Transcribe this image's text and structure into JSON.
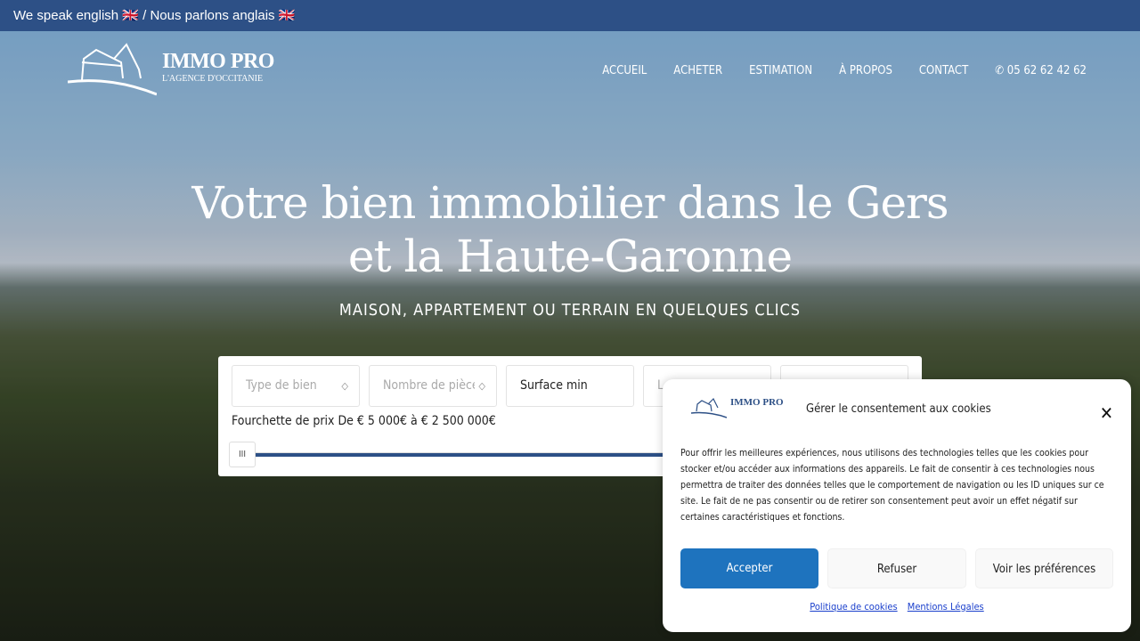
{
  "topbar": {
    "text": "We speak english 🇬🇧 / Nous parlons anglais 🇬🇧"
  },
  "logo": {
    "name": "IMMO PRO",
    "tagline": "L'AGENCE D'OCCITANIE"
  },
  "nav": {
    "items": [
      "ACCUEIL",
      "ACHETER",
      "ESTIMATION",
      "À PROPOS",
      "CONTACT"
    ],
    "phone": "05 62 62 42 62",
    "phone_icon": "phone-ringing-icon"
  },
  "hero": {
    "title_line1": "Votre bien immobilier dans le Gers",
    "title_line2": "et la Haute-Garonne",
    "subtitle": "MAISON, APPARTEMENT OU TERRAIN EN QUELQUES CLICS"
  },
  "search": {
    "type_placeholder": "Type de bien",
    "rooms_placeholder": "Nombre de pièces",
    "surface_value": "Surface min",
    "field4": "L",
    "price_label": "Fourchette de prix De € 5 000€ à € 2 500 000€",
    "handle": "III"
  },
  "cookie": {
    "title": "Gérer le consentement aux cookies",
    "text": "Pour offrir les meilleures expériences, nous utilisons des technologies telles que les cookies pour stocker et/ou accéder aux informations des appareils. Le fait de consentir à ces technologies nous permettra de traiter des données telles que le comportement de navigation ou les ID uniques sur ce site. Le fait de ne pas consentir ou de retirer son consentement peut avoir un effet négatif sur certaines caractéristiques et fonctions.",
    "accept": "Accepter",
    "refuse": "Refuser",
    "preferences": "Voir les préférences",
    "link1": "Politique de cookies",
    "link2": "Mentions Légales",
    "close": "✕",
    "accent": "#1e73be"
  }
}
